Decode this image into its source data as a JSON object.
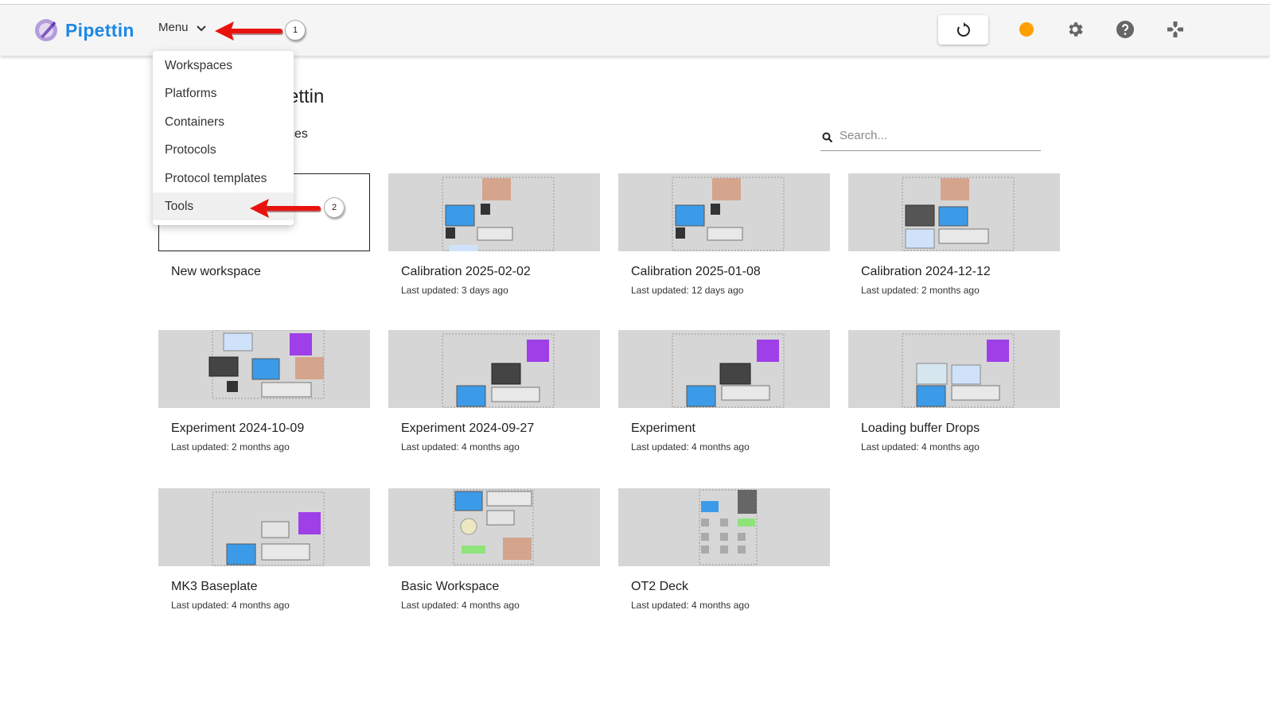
{
  "app": {
    "name": "Pipettin",
    "logo_icon": "pipette-logo-icon",
    "accent": "#1e88e5"
  },
  "header": {
    "menu_label": "Menu",
    "refresh_icon": "refresh-icon",
    "status_color": "#ffa000",
    "settings_icon": "gear-icon",
    "help_icon": "help-icon",
    "controller_icon": "gamepad-icon"
  },
  "dropdown": {
    "items": [
      "Workspaces",
      "Platforms",
      "Containers",
      "Protocols",
      "Protocol templates",
      "Tools"
    ]
  },
  "page": {
    "title": "ettin",
    "section": "ces"
  },
  "search": {
    "placeholder": "Search..."
  },
  "cards": [
    {
      "title": "New workspace",
      "sub": ""
    },
    {
      "title": "Calibration 2025-02-02",
      "sub": "Last updated: 3 days ago"
    },
    {
      "title": "Calibration 2025-01-08",
      "sub": "Last updated: 12 days ago"
    },
    {
      "title": "Calibration 2024-12-12",
      "sub": "Last updated: 2 months ago"
    },
    {
      "title": "Experiment 2024-10-09",
      "sub": "Last updated: 2 months ago"
    },
    {
      "title": "Experiment 2024-09-27",
      "sub": "Last updated: 4 months ago"
    },
    {
      "title": "Experiment",
      "sub": "Last updated: 4 months ago"
    },
    {
      "title": "Loading buffer Drops",
      "sub": "Last updated: 4 months ago"
    },
    {
      "title": "MK3 Baseplate",
      "sub": "Last updated: 4 months ago"
    },
    {
      "title": "Basic Workspace",
      "sub": "Last updated: 4 months ago"
    },
    {
      "title": "OT2 Deck",
      "sub": "Last updated: 4 months ago"
    }
  ],
  "annotations": {
    "badge1": "1",
    "badge2": "2",
    "arrow_color": "#e8130f"
  }
}
